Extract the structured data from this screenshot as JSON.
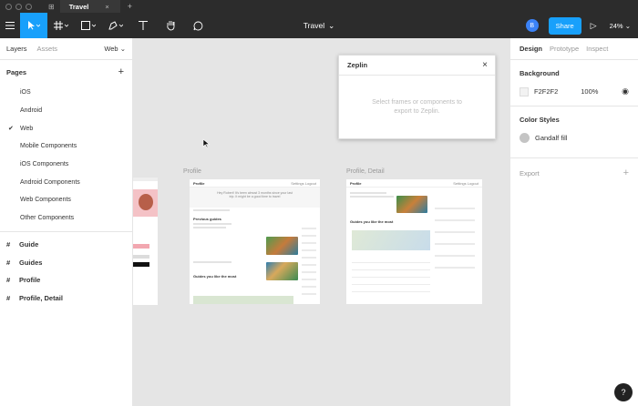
{
  "tab": {
    "title": "Travel",
    "close": "×",
    "new": "+"
  },
  "toolbar": {
    "doc_title": "Travel",
    "doc_chevron": "⌄",
    "avatar": "B",
    "share": "Share",
    "zoom": "24%"
  },
  "left_panel": {
    "tabs": {
      "layers": "Layers",
      "assets": "Assets",
      "page": "Web"
    },
    "pages_header": "Pages",
    "pages": [
      "iOS",
      "Android",
      "Web",
      "Mobile Components",
      "iOS Components",
      "Android Components",
      "Web Components",
      "Other Components"
    ],
    "checked_page": "✔",
    "frames": [
      "Guide",
      "Guides",
      "Profile",
      "Profile, Detail"
    ]
  },
  "canvas": {
    "frame_labels": [
      "Profile",
      "Profile, Detail"
    ],
    "profile": {
      "header": "Profile",
      "nav": "Settings  Logout",
      "subhead": "Previous guides",
      "subhead2": "Guides you like the most",
      "banner": "Hey Robert! It's been almost 3 months since your last trip. It might be a good time to travel"
    },
    "detail": {
      "header": "Profile",
      "nav": "Settings  Logout",
      "subhead": "Guides you like the most"
    }
  },
  "zeplin": {
    "title": "Zeplin",
    "close": "×",
    "body": "Select frames or components to export to Zeplin."
  },
  "right_panel": {
    "tabs": {
      "design": "Design",
      "prototype": "Prototype",
      "inspect": "Inspect"
    },
    "background_title": "Background",
    "background_hex": "F2F2F2",
    "background_opacity": "100%",
    "color_styles_title": "Color Styles",
    "color_style": "Gandalf fill",
    "export_title": "Export",
    "export_add": "+"
  },
  "help": "?",
  "colors": {
    "accent": "#18a0fb",
    "toolbar": "#2c2c2c",
    "canvas": "#e5e5e5"
  }
}
